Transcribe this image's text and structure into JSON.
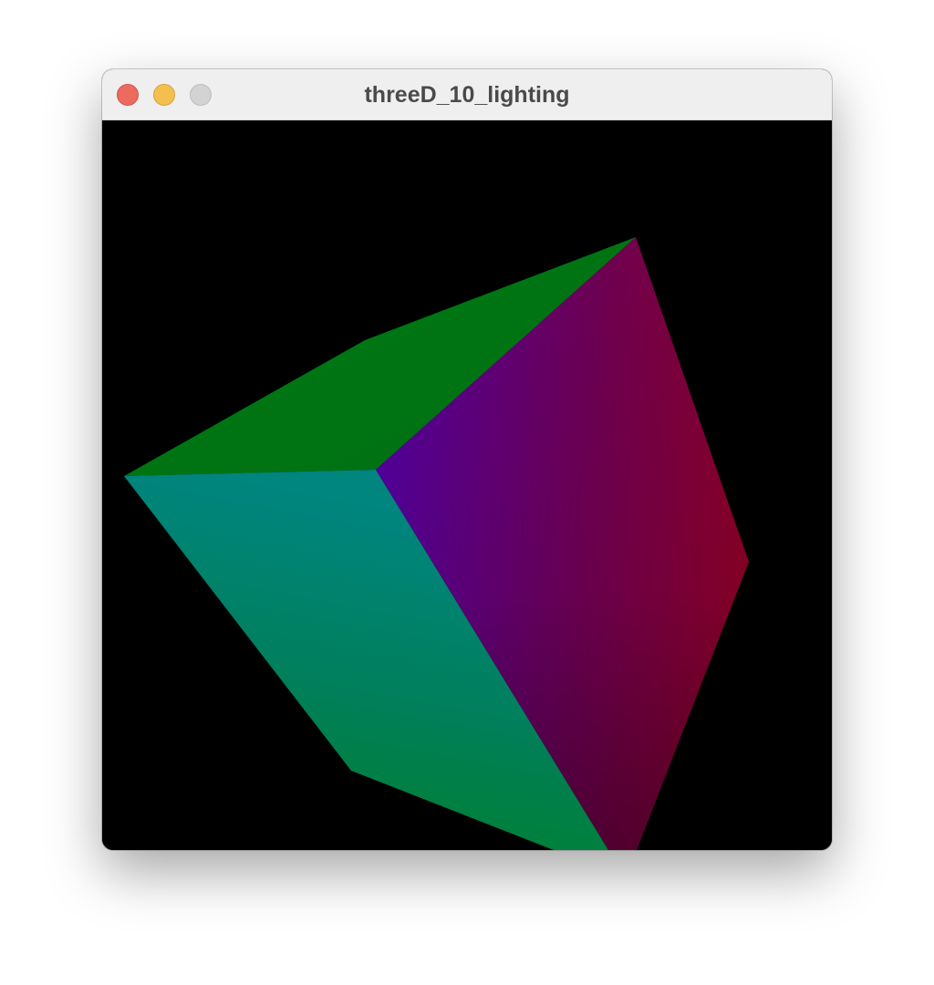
{
  "window": {
    "title": "threeD_10_lighting",
    "controls": {
      "close_icon": "close-icon",
      "minimize_icon": "minimize-icon",
      "zoom_icon": "zoom-icon"
    },
    "colors": {
      "close": "#ed6a5e",
      "minimize": "#f5bf4f",
      "zoom": "#d3d3d3",
      "titlebar": "#efefef",
      "canvas_background": "#000000"
    }
  },
  "scene": {
    "object": "lit cube",
    "face_colors": {
      "top": "#007613",
      "left_front": "#00857a",
      "right_front": "#5e0072"
    }
  }
}
